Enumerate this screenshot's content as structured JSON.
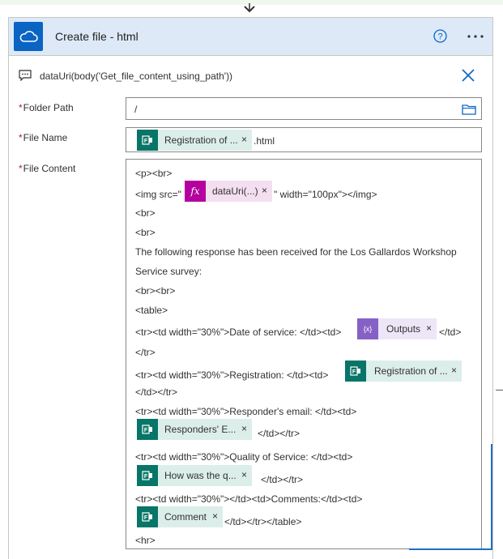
{
  "action": {
    "title": "Create file - html",
    "header_color": "#dde9f7",
    "icon": "onedrive-cloud-icon",
    "icon_color": "#0a64c4"
  },
  "expression_bar": {
    "text": "dataUri(body('Get_file_content_using_path'))"
  },
  "fields": {
    "folder_path": {
      "label": "Folder Path",
      "required_mark": "*",
      "value": "/"
    },
    "file_name": {
      "label": "File Name",
      "required_mark": "*",
      "token": "Registration of ...",
      "suffix": ".html"
    },
    "file_content": {
      "label": "File Content",
      "required_mark": "*"
    }
  },
  "content": {
    "l1": "<p><br>",
    "l2a": "<img src=\"",
    "l2_token": "dataUri(...)",
    "l2b": "\" width=\"100px\"></img>",
    "l3": "<br>",
    "l4": "<br>",
    "l5": "The following response has been received for the Los Gallardos Workshop",
    "l6": "Service survey:",
    "l7": "<br><br>",
    "l8": "<table>",
    "l9a": "<tr><td width=\"30%\">Date of service: </td><td>",
    "l9_token": "Outputs",
    "l9b": "</td>",
    "l10": "</tr>",
    "l11a": "<tr><td width=\"30%\">Registration: </td><td>",
    "l11_token": "Registration of ...",
    "l12": "</td></tr>",
    "l13": "<tr><td width=\"30%\">Responder's email: </td><td>",
    "l14_token": "Responders' E...",
    "l14b": "</td></tr>",
    "l15": "<tr><td width=\"30%\">Quality of Service: </td><td>",
    "l16_token": "How was the q...",
    "l16b": "</td></tr>",
    "l17": "<tr><td width=\"30%\"></td><td>Comments:</td><td>",
    "l18_token": "Comment",
    "l18b": "</td></tr></table>",
    "l19": "<hr>"
  },
  "token_close": "×",
  "colors": {
    "forms_token_bg": "#dceeea",
    "forms_icon_bg": "#077568",
    "expression_token_bg": "#f3dff0",
    "expression_icon_bg": "#b4009e",
    "variable_token_bg": "#ece6f7",
    "variable_icon_bg": "#8661c5"
  }
}
